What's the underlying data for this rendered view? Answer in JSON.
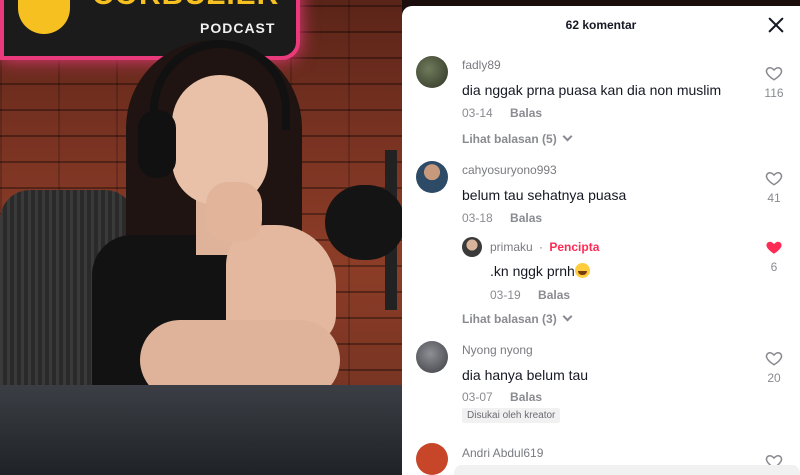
{
  "video": {
    "sign_title": "CORBUZIER",
    "sign_subtitle": "PODCAST"
  },
  "panel": {
    "comment_count": "62 komentar",
    "close_icon": "close-icon",
    "reply_label": "Balas",
    "comments": [
      {
        "username": "fadly89",
        "text": "dia nggak prna puasa kan dia non muslim",
        "date": "03-14",
        "likes": "116",
        "view_replies": "Lihat balasan (5)"
      },
      {
        "username": "cahyosuryono993",
        "text": "belum tau sehatnya puasa",
        "date": "03-18",
        "likes": "41",
        "view_replies": "Lihat balasan (3)",
        "reply": {
          "username": "primaku",
          "creator_tag": "Pencipta",
          "text": ".kn nggk prnh",
          "date": "03-19",
          "likes": "6"
        }
      },
      {
        "username": "Nyong nyong",
        "text": "dia hanya belum tau",
        "date": "03-07",
        "likes": "20",
        "badge": "Disukai oleh kreator"
      },
      {
        "username": "Andri Abdul619"
      }
    ]
  },
  "colors": {
    "like_active": "#fe2c55",
    "text_primary": "#161823",
    "text_secondary": "#8a8b91"
  }
}
